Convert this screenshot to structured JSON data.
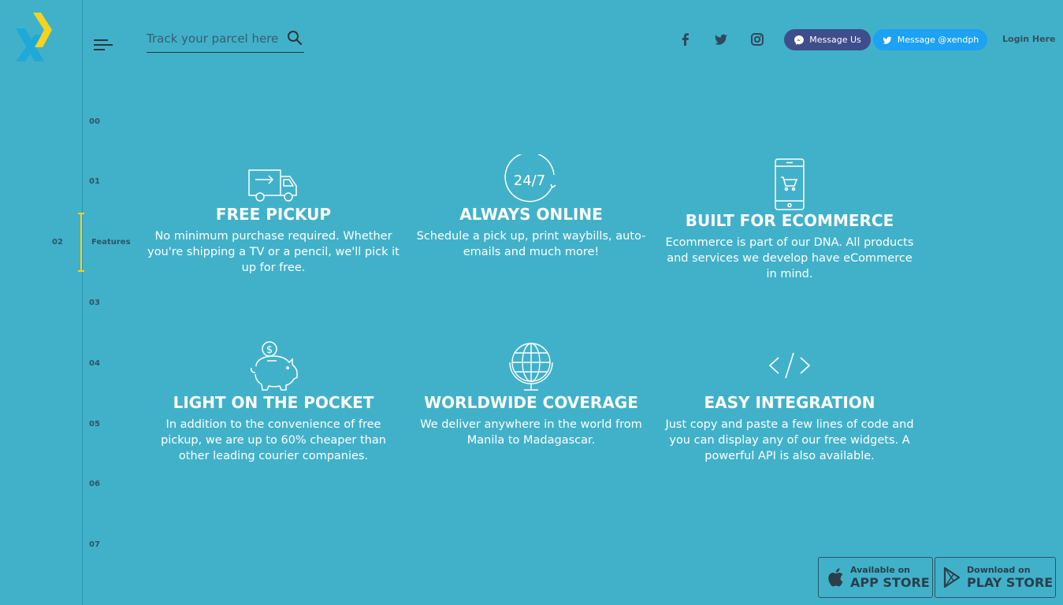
{
  "header": {
    "search_placeholder": "Track your parcel here",
    "message_us": "Message Us",
    "message_twitter": "Message @xendph",
    "login": "Login Here"
  },
  "nav": {
    "items": [
      "00",
      "01",
      "02",
      "03",
      "04",
      "05",
      "06",
      "07"
    ],
    "active_label": "Features"
  },
  "features": [
    {
      "icon": "truck-icon",
      "title": "FREE PICKUP",
      "text": "No minimum purchase required. Whether you're shipping a TV or a pencil, we'll pick it up for free."
    },
    {
      "icon": "clock-24-7-icon",
      "icon_text": "24/7",
      "title": "ALWAYS ONLINE",
      "text": "Schedule a pick up, print waybills, auto-emails and much more!"
    },
    {
      "icon": "phone-cart-icon",
      "title": "BUILT FOR ECOMMERCE",
      "text": "Ecommerce is part of our DNA. All products and services we develop have eCommerce in mind."
    },
    {
      "icon": "piggy-bank-icon",
      "icon_text": "$",
      "title": "LIGHT ON THE POCKET",
      "text": "In addition to the convenience of free pickup, we are up to 60% cheaper than other leading courier companies."
    },
    {
      "icon": "globe-icon",
      "title": "WORLDWIDE COVERAGE",
      "text": "We deliver anywhere in the world from Manila to Madagascar."
    },
    {
      "icon": "code-icon",
      "title": "EASY INTEGRATION",
      "text": "Just copy and paste a few lines of code and you can display any of our free widgets. A powerful API is also available."
    }
  ],
  "stores": {
    "app_small": "Available on",
    "app_big": "APP STORE",
    "play_small": "Download on",
    "play_big": "PLAY STORE"
  },
  "colors": {
    "background": "#41b1ca",
    "accent_yellow": "#f5d320",
    "messenger": "#3e4e8c",
    "twitter": "#1da1f2"
  }
}
